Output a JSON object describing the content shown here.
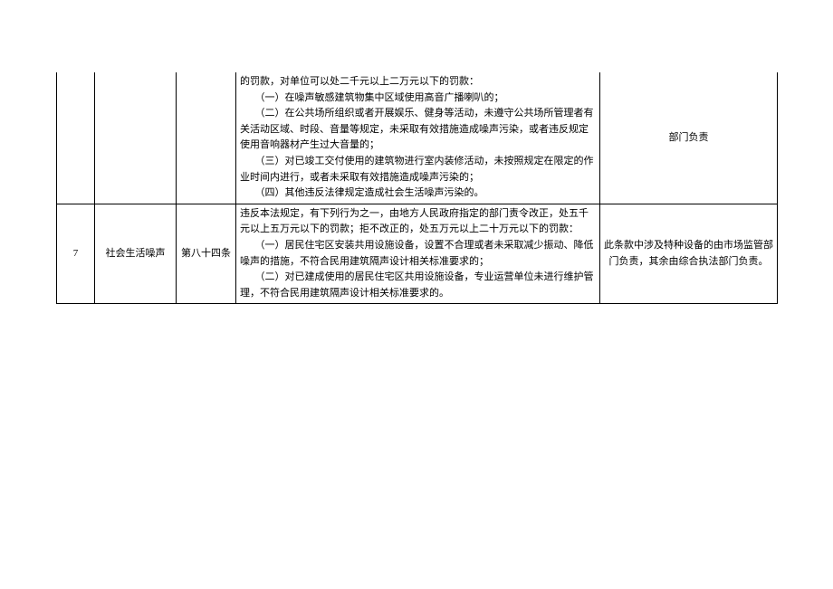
{
  "rows": [
    {
      "index": "",
      "category": "",
      "article": "",
      "content_lines": [
        "的罚款，对单位可以处二千元以上二万元以下的罚款：",
        "　　（一）在噪声敏感建筑物集中区域使用高音广播喇叭的；",
        "　　（二）在公共场所组织或者开展娱乐、健身等活动，未遵守公共场所管理者有关活动区域、时段、音量等规定，未采取有效措施造成噪声污染，或者违反规定使用音响器材产生过大音量的；",
        "　　（三）对已竣工交付使用的建筑物进行室内装修活动，未按照规定在限定的作业时间内进行，或者未采取有效措施造成噪声污染的；",
        "　　（四）其他违反法律规定造成社会生活噪声污染的。"
      ],
      "responsibility": "部门负责"
    },
    {
      "index": "7",
      "category": "社会生活噪声",
      "article": "第八十四条",
      "content_lines": [
        "违反本法规定，有下列行为之一，由地方人民政府指定的部门责令改正，处五千元以上五万元以下的罚款；拒不改正的，处五万元以上二十万元以下的罚款：",
        "　　（一）居民住宅区安装共用设施设备，设置不合理或者未采取减少振动、降低噪声的措施，不符合民用建筑隔声设计相关标准要求的；",
        "　　（二）对已建成使用的居民住宅区共用设施设备，专业运营单位未进行维护管理，不符合民用建筑隔声设计相关标准要求的。"
      ],
      "responsibility": "此条款中涉及特种设备的由市场监管部门负责，其余由综合执法部门负责。"
    }
  ]
}
